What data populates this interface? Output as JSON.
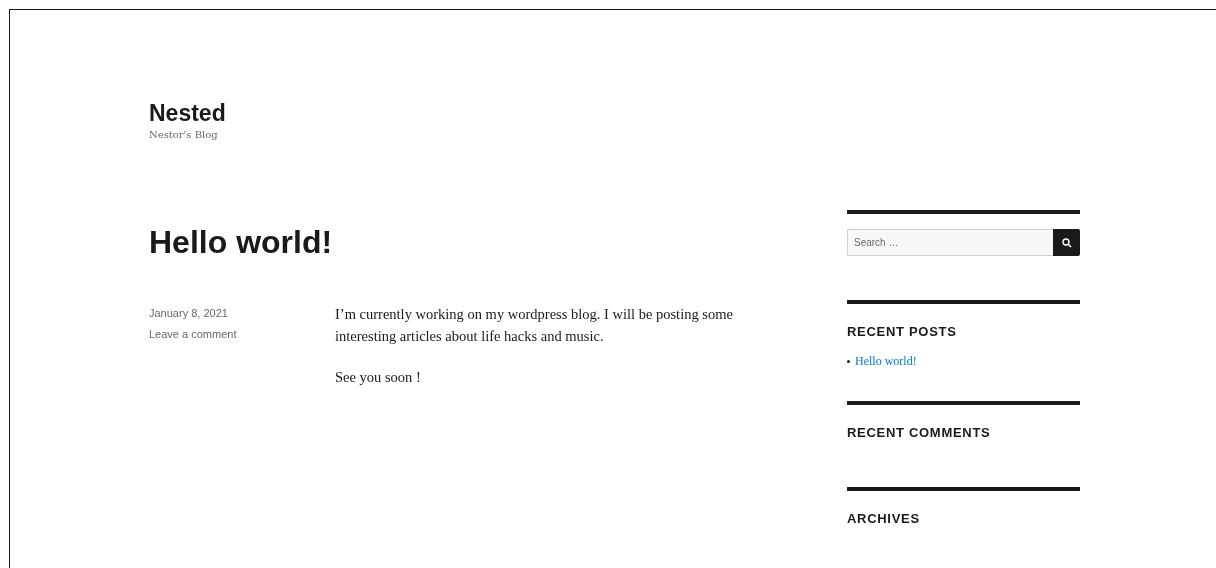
{
  "site": {
    "title": "Nested",
    "tagline": "Nestor's Blog"
  },
  "post": {
    "title": "Hello world!",
    "date": "January 8, 2021",
    "comment_link": "Leave a comment",
    "paragraphs": [
      "I’m currently working on my wordpress blog. I will be posting some interesting articles about life hacks and music.",
      "See you soon !"
    ]
  },
  "sidebar": {
    "search": {
      "placeholder": "Search …"
    },
    "widgets": [
      {
        "title": "RECENT POSTS",
        "links": [
          "Hello world!"
        ]
      },
      {
        "title": "RECENT COMMENTS"
      },
      {
        "title": "ARCHIVES"
      }
    ]
  }
}
